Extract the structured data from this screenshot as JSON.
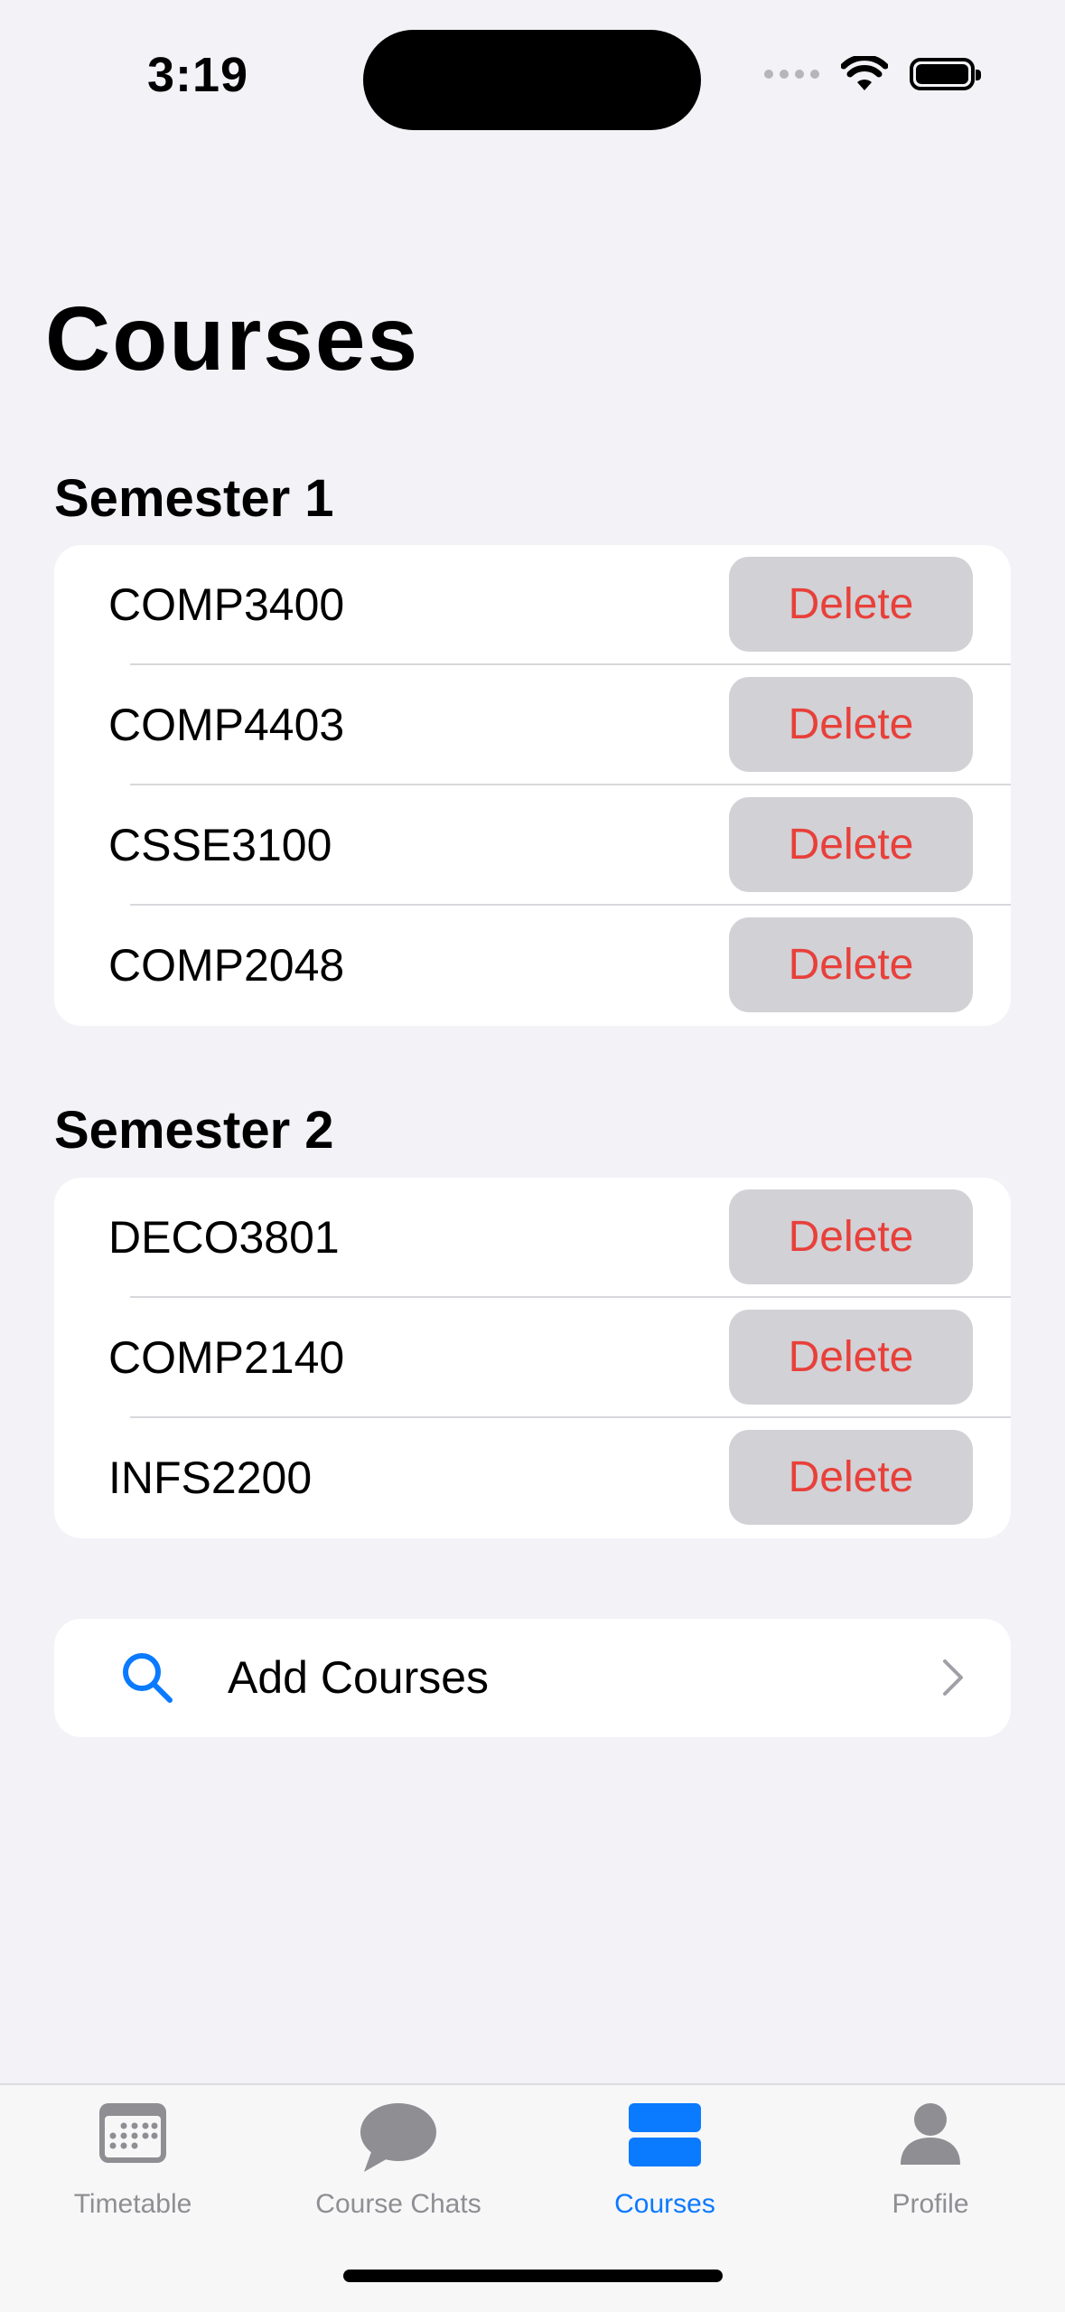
{
  "status": {
    "time": "3:19"
  },
  "header": {
    "title": "Courses"
  },
  "sections": [
    {
      "title": "Semester 1",
      "courses": [
        {
          "code": "COMP3400",
          "action": "Delete"
        },
        {
          "code": "COMP4403",
          "action": "Delete"
        },
        {
          "code": "CSSE3100",
          "action": "Delete"
        },
        {
          "code": "COMP2048",
          "action": "Delete"
        }
      ]
    },
    {
      "title": "Semester 2",
      "courses": [
        {
          "code": "DECO3801",
          "action": "Delete"
        },
        {
          "code": "COMP2140",
          "action": "Delete"
        },
        {
          "code": "INFS2200",
          "action": "Delete"
        }
      ]
    }
  ],
  "add_courses": {
    "label": "Add Courses",
    "icon": "search-icon"
  },
  "tabs": [
    {
      "label": "Timetable",
      "icon": "calendar-icon",
      "active": false
    },
    {
      "label": "Course Chats",
      "icon": "chat-bubble-icon",
      "active": false
    },
    {
      "label": "Courses",
      "icon": "courses-stack-icon",
      "active": true
    },
    {
      "label": "Profile",
      "icon": "person-icon",
      "active": false
    }
  ],
  "colors": {
    "accent": "#0A7AFF",
    "destructive": "#E8403A",
    "background": "#F2F2F7"
  }
}
